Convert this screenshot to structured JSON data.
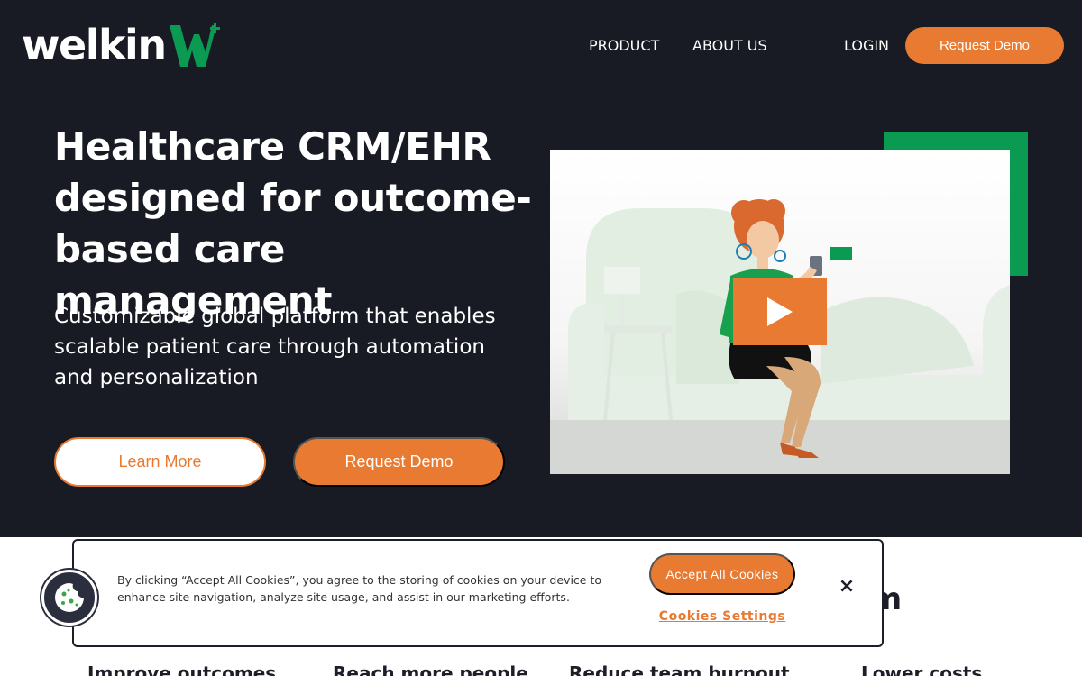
{
  "header": {
    "logo_text": "welkin",
    "nav": {
      "product": "PRODUCT",
      "about": "ABOUT US",
      "login": "LOGIN"
    },
    "request_demo": "Request Demo"
  },
  "hero": {
    "title": "Healthcare CRM/EHR designed for outcome-based care management",
    "subtitle": "Customizable global platform that enables scalable patient care through automation and personalization",
    "learn_more": "Learn More",
    "request_demo": "Request Demo"
  },
  "below": {
    "heading_fragment": "rm",
    "benefits": [
      "Improve outcomes",
      "Reach more people",
      "Reduce team burnout",
      "Lower costs"
    ]
  },
  "cookie": {
    "text": "By clicking “Accept All Cookies”, you agree to the storing of cookies on your device to enhance site navigation, analyze site usage, and assist in our marketing efforts.",
    "accept": "Accept All Cookies",
    "settings": "Cookies Settings",
    "close": "×"
  },
  "colors": {
    "brand_dark": "#181a24",
    "accent_orange": "#e87a31",
    "brand_green": "#0a9a52"
  },
  "icons": [
    "welkin-w-logo-icon",
    "play-icon",
    "close-icon",
    "cookie-icon"
  ]
}
